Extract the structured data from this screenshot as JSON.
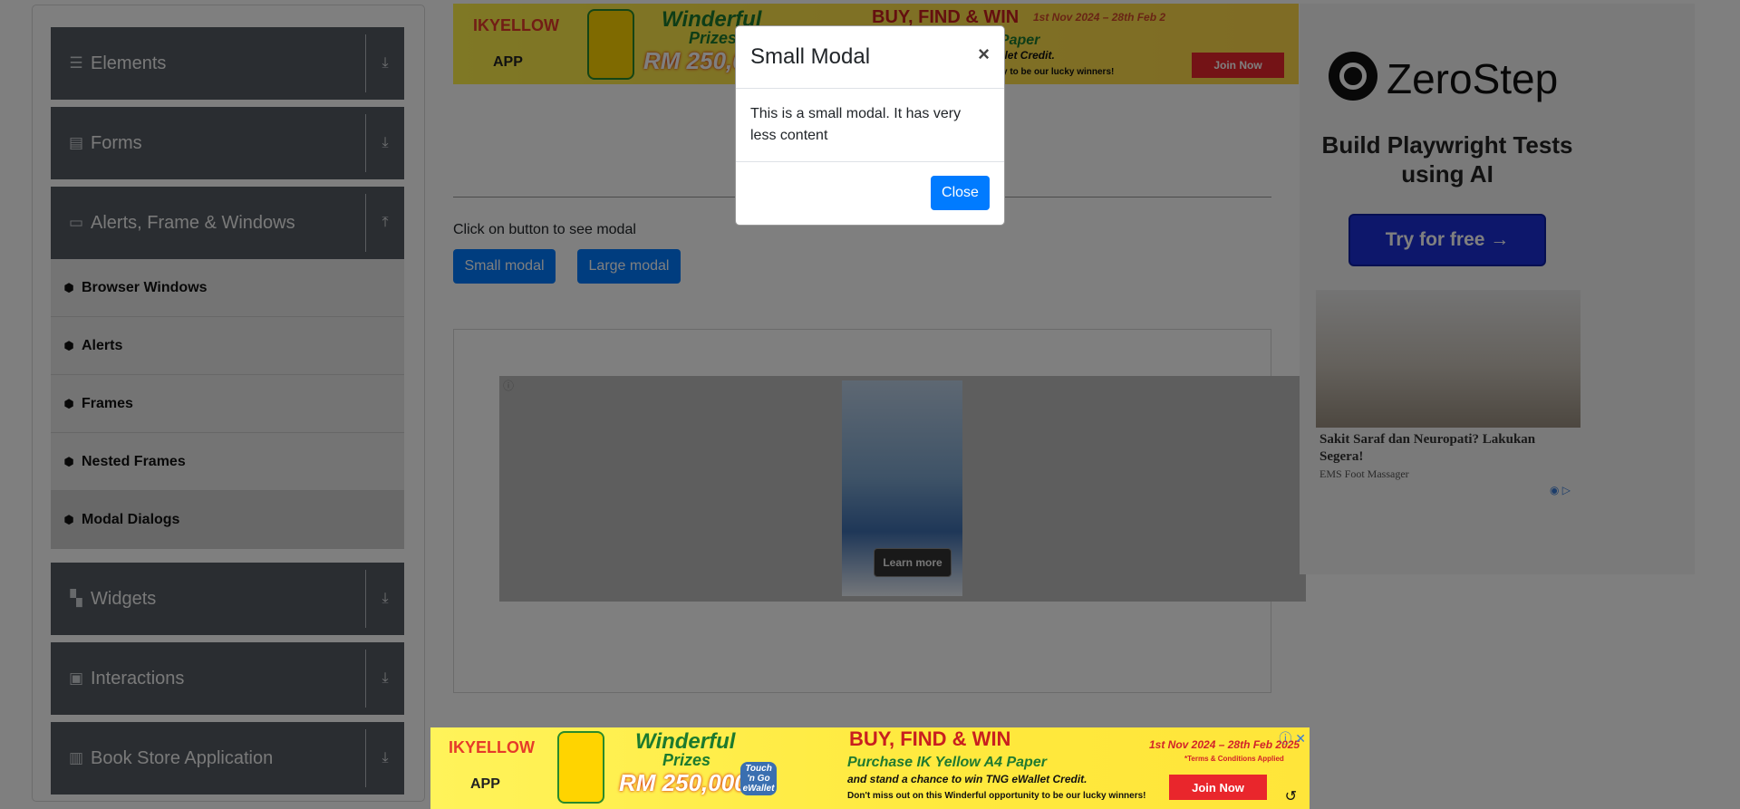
{
  "sidebar": {
    "groups": [
      {
        "label": "Elements",
        "icon": "list-icon",
        "arrow": "download-icon"
      },
      {
        "label": "Forms",
        "icon": "document-icon",
        "arrow": "download-icon"
      },
      {
        "label": "Alerts, Frame & Windows",
        "icon": "window-icon",
        "arrow": "upload-icon"
      },
      {
        "label": "Widgets",
        "icon": "widgets-icon",
        "arrow": "download-icon"
      },
      {
        "label": "Interactions",
        "icon": "interaction-icon",
        "arrow": "download-icon"
      },
      {
        "label": "Book Store Application",
        "icon": "book-icon",
        "arrow": "download-icon"
      }
    ],
    "alerts_items": [
      {
        "label": "Browser Windows"
      },
      {
        "label": "Alerts"
      },
      {
        "label": "Frames"
      },
      {
        "label": "Nested Frames"
      },
      {
        "label": "Modal Dialogs"
      }
    ]
  },
  "main": {
    "prompt": "Click on button to see modal",
    "small_modal_button": "Small modal",
    "large_modal_button": "Large modal",
    "learn_more": "Learn more"
  },
  "top_ad": {
    "brand": "IKYELLOW",
    "app": "APP",
    "headline": "BUY, FIND & WIN",
    "prize_line1": "Winderful",
    "prize_line2": "Prizes",
    "amount": "RM 250,000",
    "paper": "A4 Paper",
    "credit": "TNG eWallet Credit.",
    "date": "1st Nov 2024 – 28th Feb 2",
    "lucky": "opportunity to be our lucky winners!",
    "join": "Join Now"
  },
  "right_ad": {
    "brand": "ZeroStep",
    "tagline": "Build Playwright Tests using AI",
    "cta": "Try for free →",
    "promo_title": "Sakit Saraf dan Neuropati? Lakukan Segera!",
    "promo_source": "EMS Foot Massager"
  },
  "modal": {
    "title": "Small Modal",
    "close_x": "×",
    "body": "This is a small modal. It has very less content",
    "close_button": "Close"
  },
  "bottom_ad": {
    "brand": "IKYELLOW",
    "app": "APP",
    "headline": "BUY, FIND & WIN",
    "prize_line1": "Winderful",
    "prize_line2": "Prizes",
    "amount": "RM 250,000",
    "touch": "Touch 'n Go eWallet",
    "purchase": "Purchase IK Yellow A4 Paper",
    "stand": "and stand a chance to win TNG eWallet Credit.",
    "dont_miss": "Don't miss out on this Winderful opportunity to be our lucky winners!",
    "date": "1st Nov 2024 – 28th Feb 2025",
    "terms": "*Terms & Conditions Applied",
    "join": "Join Now",
    "replay": "↺"
  },
  "colors": {
    "primary": "#007bff",
    "sidebar_group": "#545b62",
    "overlay": "rgba(0,0,0,0.5)"
  }
}
